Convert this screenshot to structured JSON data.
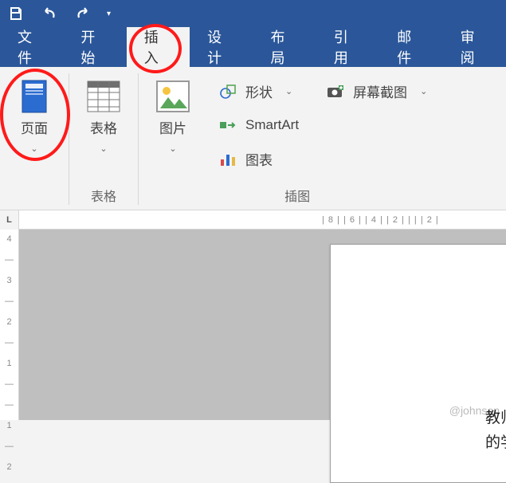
{
  "qat": {
    "save": "save",
    "undo": "undo",
    "redo": "redo"
  },
  "tabs": {
    "items": [
      {
        "label": "文件"
      },
      {
        "label": "开始"
      },
      {
        "label": "插入"
      },
      {
        "label": "设计"
      },
      {
        "label": "布局"
      },
      {
        "label": "引用"
      },
      {
        "label": "邮件"
      },
      {
        "label": "审阅"
      }
    ],
    "active_index": 2
  },
  "ribbon": {
    "pages": {
      "label": "页面",
      "group_label": ""
    },
    "tables": {
      "label": "表格",
      "group_label": "表格"
    },
    "pictures": {
      "label": "图片"
    },
    "shapes": {
      "label": "形状"
    },
    "smartart": {
      "label": "SmartArt"
    },
    "chart": {
      "label": "图表"
    },
    "screenshot": {
      "label": "屏幕截图"
    },
    "illustrations_group_label": "插图"
  },
  "ruler": {
    "corner": "L",
    "h_marks": "| 8 |    | 6 |    | 4 |    | 2 |    |    |    | 2 |",
    "v_marks": [
      "4",
      "—",
      "3",
      "—",
      "2",
      "—",
      "1",
      "—",
      "—",
      "1",
      "—",
      "2"
    ]
  },
  "document": {
    "line1": "教师",
    "line2": "的学"
  },
  "watermark": "@johnson"
}
